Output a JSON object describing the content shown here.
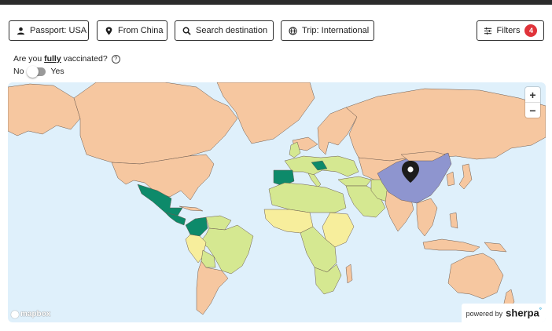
{
  "filters": {
    "passport": {
      "label": "Passport: USA",
      "icon": "person-icon"
    },
    "origin": {
      "label": "From China",
      "icon": "location-pin-icon"
    },
    "destination": {
      "label": "Search destination",
      "icon": "search-icon"
    },
    "trip": {
      "label": "Trip: International",
      "icon": "globe-icon"
    },
    "filters_button": {
      "label": "Filters",
      "count": "4",
      "icon": "sliders-icon"
    }
  },
  "vaccination": {
    "question_prefix": "Are you ",
    "question_emphasis": "fully",
    "question_suffix": " vaccinated?",
    "help_icon": "?",
    "no_label": "No",
    "yes_label": "Yes",
    "toggle_on": false
  },
  "map": {
    "zoom_in": "+",
    "zoom_out": "−",
    "attribution": "mapbox",
    "powered_prefix": "powered by",
    "powered_brand": "sherpa",
    "powered_mark": "°",
    "selected_origin": "China",
    "colors": {
      "ocean": "#dff0fb",
      "restricted": "#f6c7a0",
      "origin": "#8e95cf",
      "open": "#0d8a6a",
      "partial": "#d5e891",
      "moderate": "#f7ee9c",
      "border": "#6b5a4f"
    }
  }
}
